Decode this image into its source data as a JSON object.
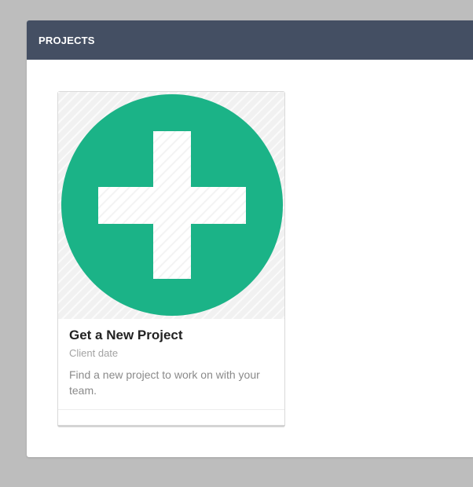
{
  "panel": {
    "title": "PROJECTS"
  },
  "card": {
    "image_icon": "plus-circle-icon",
    "title": "Get a New Project",
    "subtitle": "Client date",
    "description": "Find a new project to work on with your team."
  },
  "colors": {
    "header_bg": "#444f63",
    "accent_green": "#1bb387",
    "page_bg": "#bdbdbd"
  }
}
